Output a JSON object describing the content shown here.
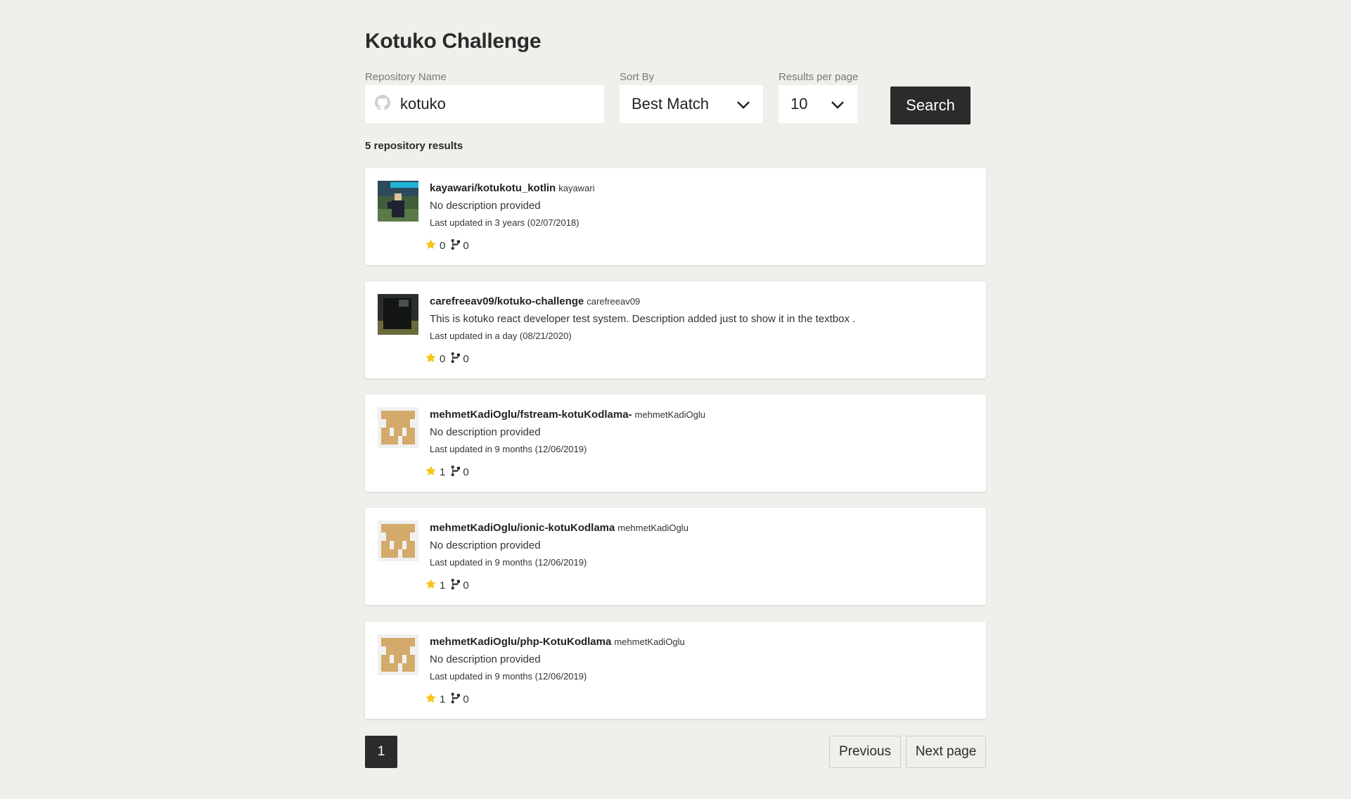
{
  "header": {
    "title": "Kotuko Challenge"
  },
  "form": {
    "repo_label": "Repository Name",
    "repo_value": "kotuko",
    "sort_label": "Sort By",
    "sort_value": "Best Match",
    "per_page_label": "Results per page",
    "per_page_value": "10",
    "search_label": "Search"
  },
  "results": {
    "count_text": "5 repository results",
    "items": [
      {
        "name": "kayawari/kotukotu_kotlin",
        "owner": "kayawari",
        "description": "No description provided",
        "updated": "Last updated in 3 years (02/07/2018)",
        "stars": "0",
        "forks": "0",
        "avatar": "photo-field"
      },
      {
        "name": "carefreeav09/kotuko-challenge",
        "owner": "carefreeav09",
        "description": "This is kotuko react developer test system. Description added just to show it in the textbox .",
        "updated": "Last updated in a day (08/21/2020)",
        "stars": "0",
        "forks": "0",
        "avatar": "photo-dark"
      },
      {
        "name": "mehmetKadiOglu/fstream-kotuKodlama-",
        "owner": "mehmetKadiOglu",
        "description": "No description provided",
        "updated": "Last updated in 9 months (12/06/2019)",
        "stars": "1",
        "forks": "0",
        "avatar": "identicon"
      },
      {
        "name": "mehmetKadiOglu/ionic-kotuKodlama",
        "owner": "mehmetKadiOglu",
        "description": "No description provided",
        "updated": "Last updated in 9 months (12/06/2019)",
        "stars": "1",
        "forks": "0",
        "avatar": "identicon"
      },
      {
        "name": "mehmetKadiOglu/php-KotuKodlama",
        "owner": "mehmetKadiOglu",
        "description": "No description provided",
        "updated": "Last updated in 9 months (12/06/2019)",
        "stars": "1",
        "forks": "0",
        "avatar": "identicon"
      }
    ]
  },
  "pagination": {
    "current": "1",
    "previous_label": "Previous",
    "next_label": "Next page"
  },
  "colors": {
    "background": "#efefeb",
    "dark": "#2b2b2b",
    "star": "#f5c518",
    "identicon": "#d3aa6a"
  }
}
